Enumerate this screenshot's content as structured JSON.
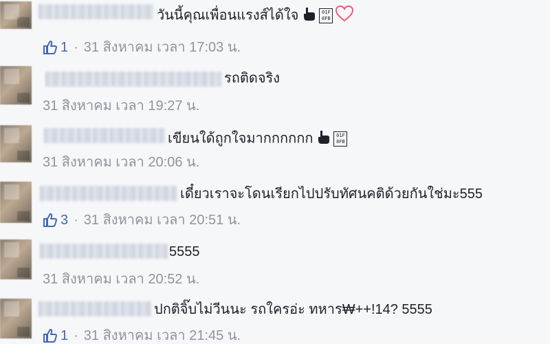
{
  "comments": [
    {
      "text": "วันนี้คุณเพื่อนแรงส์ได้ใจ",
      "likes": "1",
      "date": "31 สิงหาคม เวลา 17:03 น.",
      "emoji": [
        "pointing-hand-icon",
        "unknown-glyph-box",
        "heart-icon"
      ],
      "glyph": [
        "01F",
        "8FB"
      ]
    },
    {
      "text": "รถติดจริง",
      "likes": "",
      "date": "31 สิงหาคม เวลา 19:27 น.",
      "emoji": []
    },
    {
      "text": "เขียนใด้ถูกใจมากกกกกก",
      "likes": "",
      "date": "31 สิงหาคม เวลา 20:06 น.",
      "emoji": [
        "pointing-hand-icon",
        "unknown-glyph-box"
      ],
      "glyph": [
        "01F",
        "8FB"
      ]
    },
    {
      "text": "เดี๋ยวเราจะโดนเรียกไปปรับทัศนคติด้วยกันใช่มะ555",
      "likes": "3",
      "date": "31 สิงหาคม เวลา 20:51 น.",
      "emoji": []
    },
    {
      "text": "5555",
      "likes": "",
      "date": "31 สิงหาคม เวลา 20:52 น.",
      "emoji": []
    },
    {
      "text": "ปกติจิ๊บไม่วีนนะ รถใครอ่ะ ทหาร₩++!14? 5555",
      "likes": "1",
      "date": "31 สิงหาคม เวลา 21:45 น.",
      "emoji": []
    }
  ],
  "separator": "·",
  "colors": {
    "link": "#4267b2",
    "meta": "#90949c",
    "text": "#1d2129",
    "heart": "#f05a78"
  }
}
